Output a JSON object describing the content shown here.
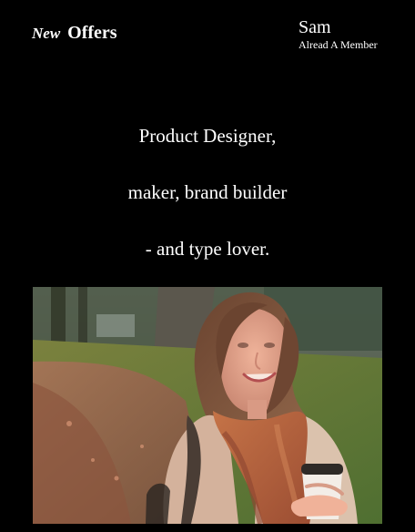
{
  "header": {
    "brand_new": "New",
    "brand_offers": "Offers",
    "user_name": "Sam",
    "member_link": "Alread A Member"
  },
  "hero": {
    "line_1": "Product Designer,",
    "line_2": "maker, brand builder",
    "line_3": "- and type lover."
  },
  "photo": {
    "subject": "smiling woman holding a coffee cup in an autumn park"
  },
  "colors": {
    "background": "#000000",
    "text": "#ffffff",
    "scarf": "#b86a44",
    "coat": "#d8b8a0"
  }
}
